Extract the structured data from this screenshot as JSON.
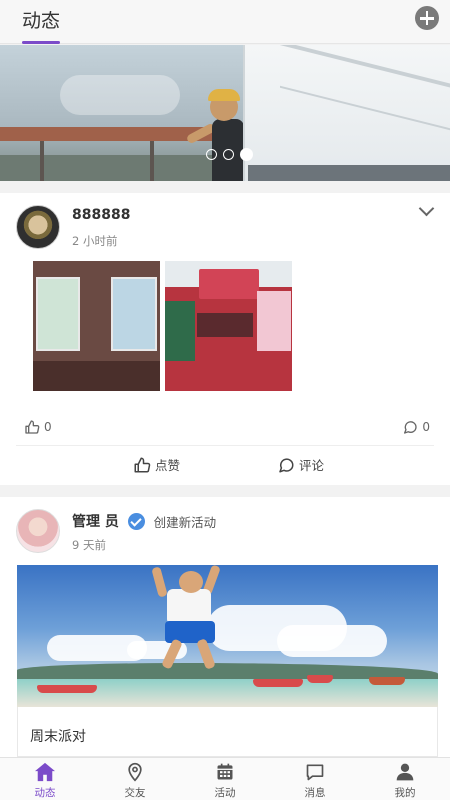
{
  "header": {
    "title": "动态",
    "add_label": "+"
  },
  "banner": {
    "slide_count": 3,
    "active_slide": 3
  },
  "posts": [
    {
      "username": "888888",
      "time": "2 小时前",
      "like_count": "0",
      "comment_count": "0",
      "like_label": "点赞",
      "comment_label": "评论",
      "photo_count": 2
    },
    {
      "username": "管理 员",
      "action": "创建新活动",
      "time": "9 天前",
      "event_title": "周末派对"
    }
  ],
  "tabbar": {
    "items": [
      {
        "label": "动态",
        "icon": "home-icon",
        "active": true
      },
      {
        "label": "交友",
        "icon": "location-pin-icon",
        "active": false
      },
      {
        "label": "活动",
        "icon": "calendar-icon",
        "active": false
      },
      {
        "label": "消息",
        "icon": "chat-bubble-icon",
        "active": false
      },
      {
        "label": "我的",
        "icon": "user-icon",
        "active": false
      }
    ]
  },
  "colors": {
    "accent": "#7b4bc9",
    "verified": "#4a8ee0"
  }
}
